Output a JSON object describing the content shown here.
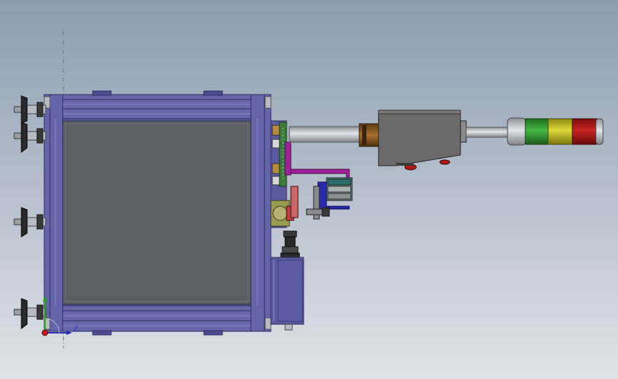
{
  "viewport": {
    "background_top": "#8c9cb0",
    "background_bottom": "#dfe3e8"
  },
  "triad": {
    "z_label": "Z"
  },
  "colors": {
    "frame": "#5a5aa0",
    "frame_dark": "#3b3b78",
    "panel": "#5e5f66",
    "rod": "#b8bcc2",
    "bronze": "#8a5a24",
    "housing": "#6c6c6c",
    "light_green": "#2f9b2f",
    "light_yellow": "#c8c41e",
    "light_red": "#b01818",
    "bracket_magenta": "#a0209a",
    "axis_z": "#2a2ab8",
    "axis_y": "#1fa01f",
    "axis_origin": "#c81818"
  }
}
